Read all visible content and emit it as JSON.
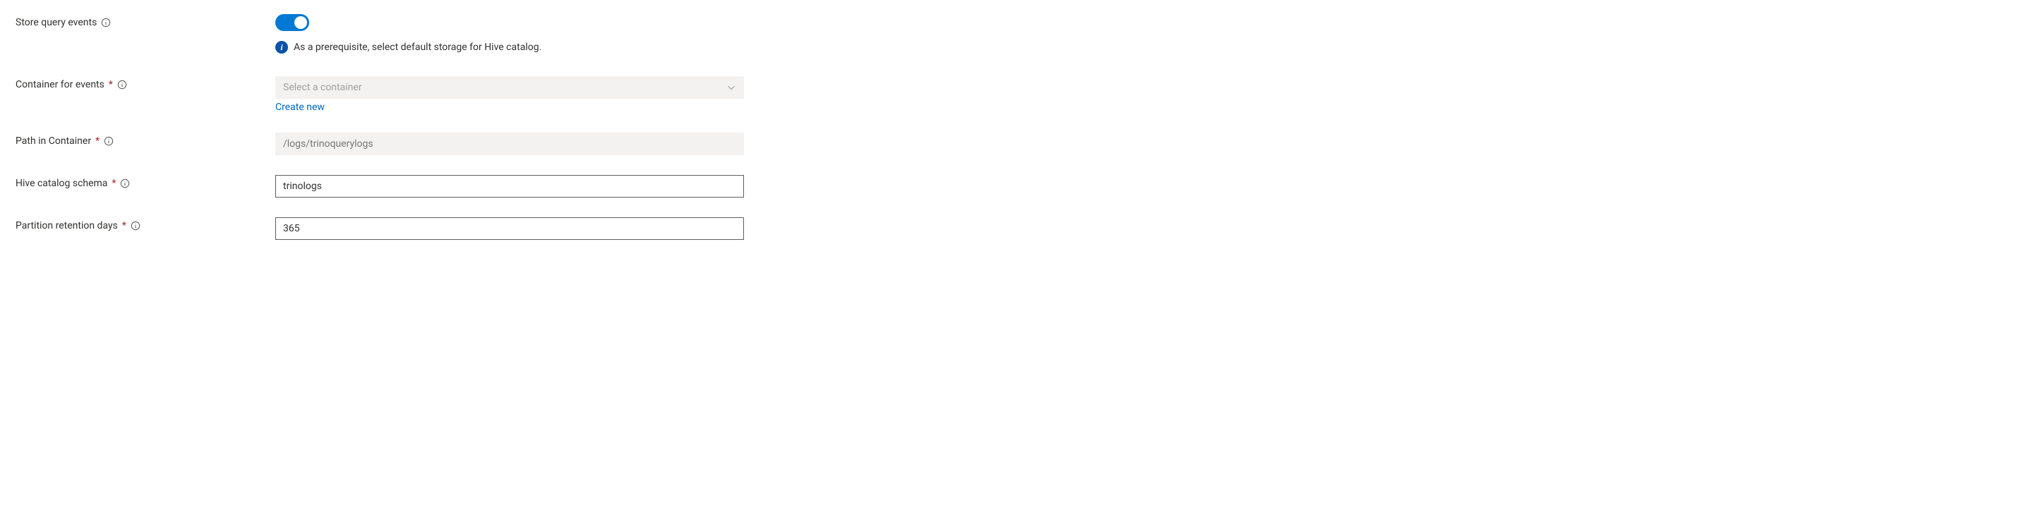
{
  "store_query_events": {
    "label": "Store query events",
    "on": true
  },
  "prerequisite_msg": "As a prerequisite, select default storage for Hive catalog.",
  "container_for_events": {
    "label": "Container for events",
    "placeholder": "Select a container",
    "value": "",
    "create_new_link": "Create new"
  },
  "path_in_container": {
    "label": "Path in Container",
    "placeholder": "/logs/trinoquerylogs",
    "value": ""
  },
  "hive_catalog_schema": {
    "label": "Hive catalog schema",
    "value": "trinologs"
  },
  "partition_retention_days": {
    "label": "Partition retention days",
    "value": "365"
  }
}
